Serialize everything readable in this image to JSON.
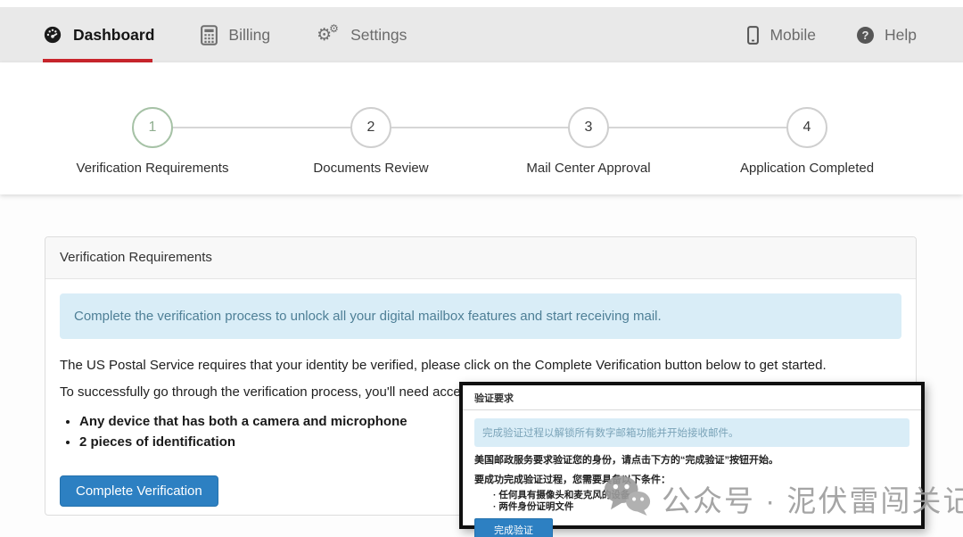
{
  "navbar": {
    "items": [
      {
        "label": "Dashboard",
        "icon": "dashboard-gauge-icon",
        "active": true
      },
      {
        "label": "Billing",
        "icon": "calculator-icon",
        "active": false
      },
      {
        "label": "Settings",
        "icon": "gears-icon",
        "active": false
      }
    ],
    "right_items": [
      {
        "label": "Mobile",
        "icon": "mobile-icon"
      },
      {
        "label": "Help",
        "icon": "help-question-icon"
      }
    ]
  },
  "stepper": {
    "steps": [
      {
        "number": "1",
        "label": "Verification Requirements",
        "state": "current"
      },
      {
        "number": "2",
        "label": "Documents Review",
        "state": "upcoming"
      },
      {
        "number": "3",
        "label": "Mail Center Approval",
        "state": "upcoming"
      },
      {
        "number": "4",
        "label": "Application Completed",
        "state": "upcoming"
      }
    ]
  },
  "card": {
    "title": "Verification Requirements",
    "info_banner": "Complete the verification process to unlock all your digital mailbox features and start receiving mail.",
    "paragraph1": "The US Postal Service requires that your identity be verified, please click on the Complete Verification button below to get started.",
    "paragraph2": "To successfully go through the verification process, you'll need access",
    "bullets": [
      "Any device that has both a camera and microphone",
      "2 pieces of identification"
    ],
    "button_label": "Complete Verification"
  },
  "popup": {
    "title": "验证要求",
    "info_banner": "完成验证过程以解锁所有数字邮箱功能并开始接收邮件。",
    "paragraph1": "美国邮政服务要求验证您的身份，请点击下方的“完成验证”按钮开始。",
    "paragraph2": "要成功完成验证过程，您需要具备以下条件：",
    "bullets": [
      "任何具有摄像头和麦克风的设备",
      "两件身份证明文件"
    ],
    "button_label": "完成验证"
  },
  "watermark": {
    "text": "公众号 · 泥伏雷闯关记",
    "icon": "wechat-icon"
  },
  "colors": {
    "accent_blue": "#2d80c2",
    "active_tab_red": "#c9252c",
    "info_banner_bg": "#d9edf7",
    "info_banner_text": "#4e7f96",
    "current_step_green": "#a6c2a6",
    "navbar_bg": "#e9e9e9"
  }
}
